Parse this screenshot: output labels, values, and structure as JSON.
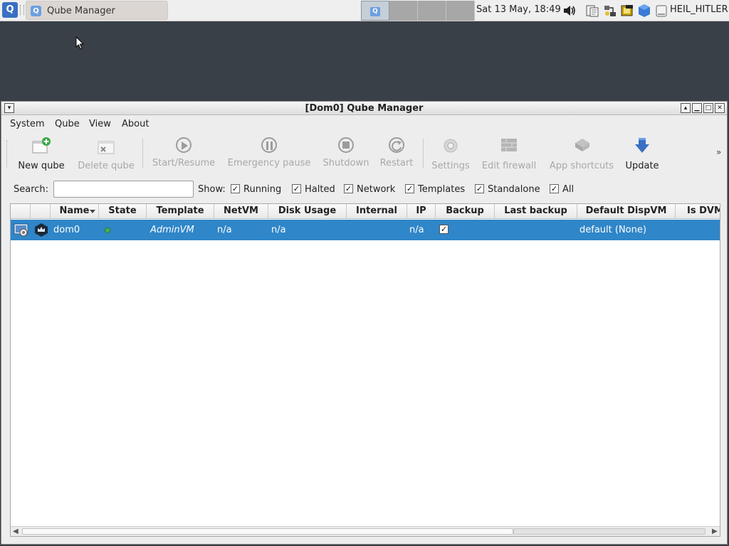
{
  "taskbar": {
    "menu_glyph": "Q",
    "task_label": "Qube Manager",
    "task_icon": "Q",
    "clock": "Sat 13 May, 18:49",
    "user": "HEIL_HITLER"
  },
  "window": {
    "title": "[Dom0] Qube Manager",
    "menus": [
      "System",
      "Qube",
      "View",
      "About"
    ],
    "toolbar": {
      "new_qube": "New qube",
      "delete_qube": "Delete qube",
      "start_resume": "Start/Resume",
      "emergency_pause": "Emergency pause",
      "shutdown": "Shutdown",
      "restart": "Restart",
      "settings": "Settings",
      "edit_firewall": "Edit firewall",
      "app_shortcuts": "App shortcuts",
      "update": "Update",
      "more": "»"
    },
    "filters": {
      "search_label": "Search:",
      "search_value": "",
      "show_label": "Show:",
      "running": "Running",
      "halted": "Halted",
      "network": "Network",
      "templates": "Templates",
      "standalone": "Standalone",
      "all": "All",
      "checked": "✓"
    },
    "table": {
      "columns": [
        "",
        "",
        "Name",
        "State",
        "Template",
        "NetVM",
        "Disk Usage",
        "Internal",
        "IP",
        "Backup",
        "Last backup",
        "Default DispVM",
        "Is DVM"
      ],
      "rows": [
        {
          "name": "dom0",
          "template": "AdminVM",
          "netvm": "n/a",
          "disk_usage": "n/a",
          "internal": "",
          "ip": "n/a",
          "backup": "✓",
          "last_backup": "",
          "default_dispvm": "default (None)"
        }
      ],
      "state_color": "#4caf50",
      "selection_color": "#2f86c8"
    }
  }
}
